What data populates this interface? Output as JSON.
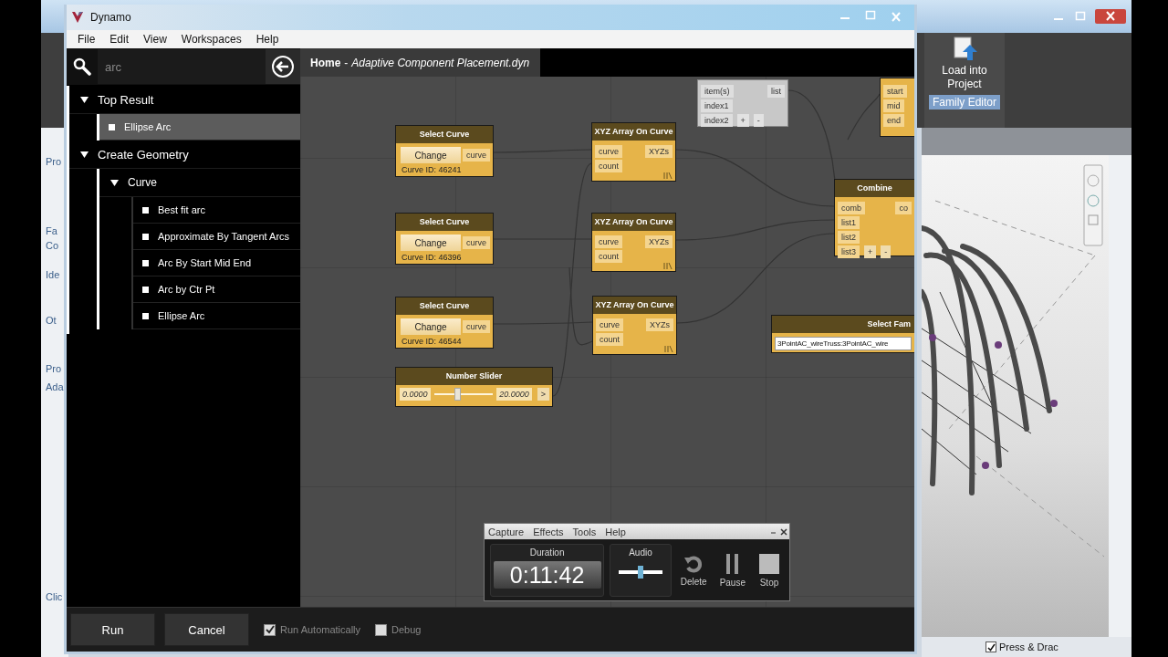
{
  "revit": {
    "left_fragments": [
      "Pro",
      "Fa",
      "Co",
      "Ide",
      "Ot",
      "Pro",
      "Ada",
      "Clic"
    ],
    "ribbon_button": "Load into Project",
    "ribbon_label": "Family Editor",
    "status": "Press & Drac",
    "status_checked": true
  },
  "dynamo": {
    "title": "Dynamo",
    "menu": [
      "File",
      "Edit",
      "View",
      "Workspaces",
      "Help"
    ],
    "search": {
      "value": "arc"
    },
    "tree": [
      {
        "label": "Top Result",
        "expanded": true,
        "children": [
          {
            "label": "Ellipse Arc",
            "selected": true
          }
        ]
      },
      {
        "label": "Create Geometry",
        "expanded": true,
        "children": [
          {
            "label": "Curve",
            "expanded": true,
            "children": [
              {
                "label": "Best fit arc",
                "selected": false
              },
              {
                "label": "Approximate By Tangent Arcs",
                "selected": false
              },
              {
                "label": "Arc By Start Mid End",
                "selected": false
              },
              {
                "label": "Arc by Ctr Pt",
                "selected": false
              },
              {
                "label": "Ellipse Arc",
                "selected": false
              }
            ]
          }
        ]
      }
    ],
    "tab": {
      "home": "Home",
      "separator": "-",
      "file": "Adaptive Component Placement.dyn"
    },
    "nodes": [
      {
        "kind": "list",
        "inactive": true,
        "inputs": [
          "item(s)",
          "index1",
          "index2"
        ],
        "add": "+",
        "remove": "-",
        "outputs": [
          "list"
        ]
      },
      {
        "kind": "partial",
        "inputs": [
          "start",
          "mid",
          "end"
        ]
      },
      {
        "kind": "select",
        "title": "Select Curve",
        "button": "Change",
        "output": "curve",
        "info": "Curve ID: 46241"
      },
      {
        "kind": "xyz",
        "title": "XYZ Array On Curve",
        "inputs": [
          "curve",
          "count"
        ],
        "outputs": [
          "XYZs"
        ]
      },
      {
        "kind": "list",
        "inactive": false,
        "title": "Combine",
        "inputs": [
          "comb",
          "list1",
          "list2",
          "list3"
        ],
        "add": "+",
        "remove": "-",
        "outputs": [
          "co"
        ]
      },
      {
        "kind": "select",
        "title": "Select Curve",
        "button": "Change",
        "output": "curve",
        "info": "Curve ID: 46396"
      },
      {
        "kind": "xyz",
        "title": "XYZ Array On Curve",
        "inputs": [
          "curve",
          "count"
        ],
        "outputs": [
          "XYZs"
        ]
      },
      {
        "kind": "select",
        "title": "Select Curve",
        "button": "Change",
        "output": "curve",
        "info": "Curve ID: 46544"
      },
      {
        "kind": "xyz",
        "title": "XYZ Array On Curve",
        "inputs": [
          "curve",
          "count"
        ],
        "outputs": [
          "XYZs"
        ]
      },
      {
        "kind": "dropdown",
        "title": "Select Fam",
        "value": "3PointAC_wireTruss:3PointAC_wire"
      },
      {
        "kind": "slider",
        "title": "Number Slider",
        "min": "0.0000",
        "max": "20.0000",
        "level": 0.4,
        "step": ">"
      }
    ],
    "footer": {
      "buttons": [
        "Run",
        "Cancel"
      ],
      "options": [
        {
          "label": "Run Automatically",
          "checked": true
        },
        {
          "label": "Debug",
          "checked": false
        }
      ]
    }
  },
  "recorder": {
    "menu": [
      "Capture",
      "Effects",
      "Tools",
      "Help"
    ],
    "duration_label": "Duration",
    "time": "0:11:42",
    "audio_label": "Audio",
    "level": 0.5,
    "buttons": [
      {
        "kind": "delete",
        "label": "Delete"
      },
      {
        "kind": "pause",
        "label": "Pause"
      },
      {
        "kind": "stop",
        "label": "Stop"
      }
    ]
  }
}
